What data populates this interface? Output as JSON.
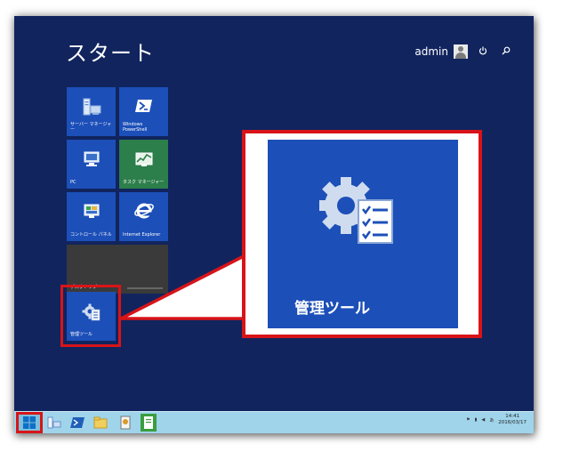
{
  "start_screen": {
    "title": "スタート",
    "user": {
      "name": "admin"
    }
  },
  "tiles": [
    {
      "label": "サーバー マネージャー",
      "icon": "server-manager-icon"
    },
    {
      "label": "Windows PowerShell",
      "icon": "powershell-icon"
    },
    {
      "label": "PC",
      "icon": "computer-icon"
    },
    {
      "label": "タスク マネージャー",
      "icon": "task-manager-icon"
    },
    {
      "label": "コントロール パネル",
      "icon": "control-panel-icon"
    },
    {
      "label": "Internet Explorer",
      "icon": "internet-explorer-icon"
    },
    {
      "label": "デスクトップ",
      "icon": "desktop-icon"
    },
    {
      "label": "管理ツール",
      "icon": "admin-tools-icon"
    }
  ],
  "callout": {
    "label": "管理ツール"
  },
  "taskbar": {
    "time": "14:41",
    "date": "2016/03/17"
  },
  "colors": {
    "background": "#11245e",
    "tile_blue": "#1c4fb8",
    "tile_green": "#2c7e4a",
    "highlight": "#d81418",
    "taskbar": "#9fd4ea"
  }
}
